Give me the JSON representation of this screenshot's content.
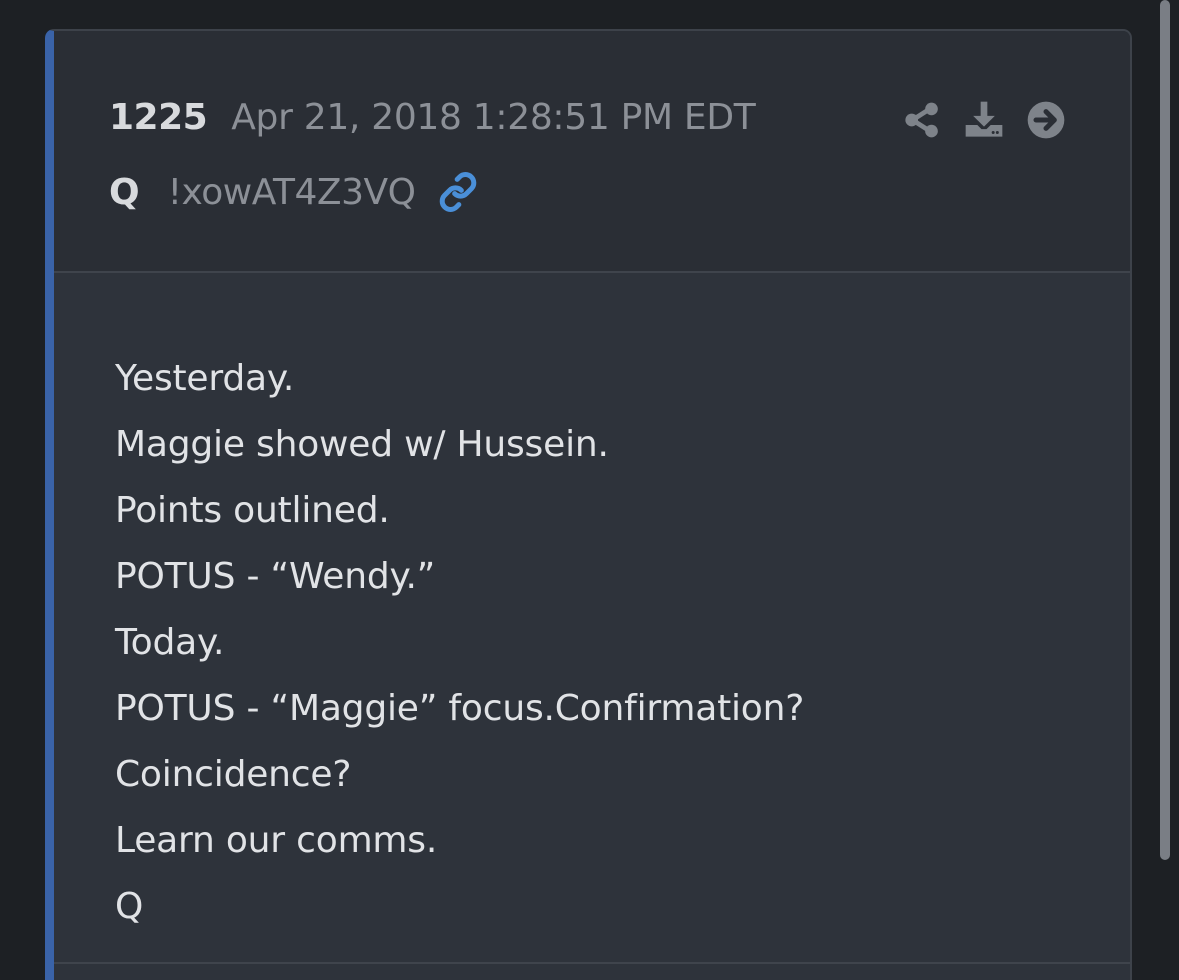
{
  "post": {
    "number": "1225",
    "date": "Apr 21, 2018 1:28:51 PM EDT",
    "author": "Q",
    "tripcode": "!xowAT4Z3VQ",
    "lines": [
      "Yesterday.",
      "Maggie showed w/ Hussein.",
      "Points outlined.",
      "POTUS - “Wendy.”",
      "Today.",
      "POTUS - “Maggie” focus.Confirmation?",
      "Coincidence?",
      "Learn our comms.",
      "Q"
    ]
  },
  "icons": {
    "link": "link-icon",
    "share": "share-icon",
    "download": "download-icon",
    "go": "arrow-circle-right-icon"
  },
  "colors": {
    "background": "#1d2024",
    "card": "#2e333b",
    "header": "#2a2e35",
    "accent_bar": "#3a63a8",
    "link": "#4a8fd8",
    "text": "#e1e3e6",
    "muted": "#8c9097",
    "icon": "#7e838a"
  }
}
